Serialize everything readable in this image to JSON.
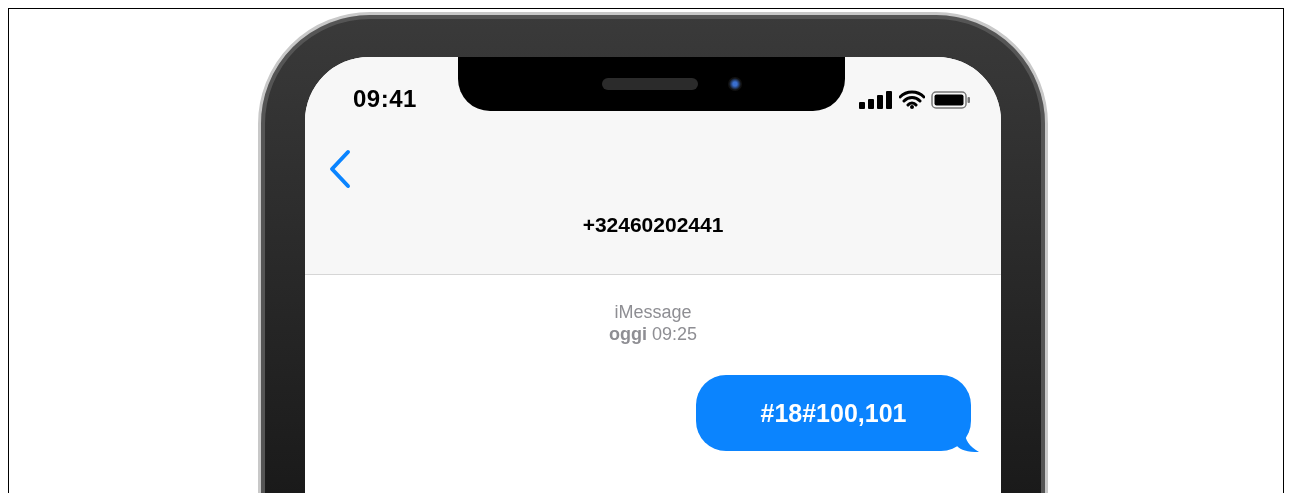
{
  "status_bar": {
    "time": "09:41"
  },
  "conversation": {
    "contact": "+32460202441"
  },
  "thread_header": {
    "service": "iMessage",
    "timestamp": "**oggi** 09:25"
  },
  "messages": [
    {
      "text": "#18#100,101",
      "kind": "sent"
    }
  ]
}
